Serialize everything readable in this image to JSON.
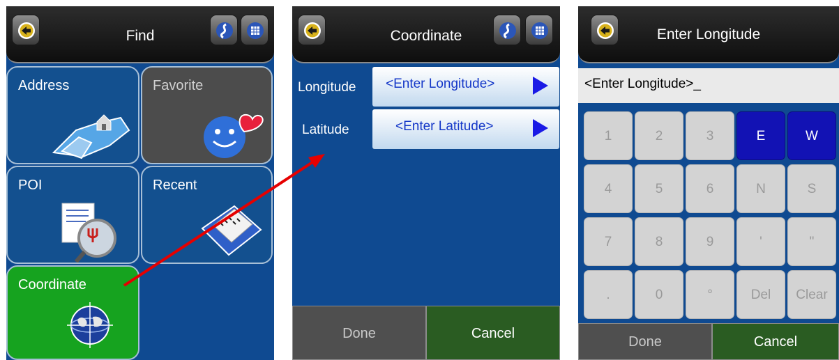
{
  "find_screen": {
    "title": "Find",
    "tiles": [
      {
        "label": "Address",
        "state": "enabled"
      },
      {
        "label": "Favorite",
        "state": "disabled"
      },
      {
        "label": "POI",
        "state": "enabled"
      },
      {
        "label": "Recent",
        "state": "enabled"
      },
      {
        "label": "Coordinate",
        "state": "selected"
      }
    ],
    "icons": {
      "back": "back-arrow-icon",
      "route": "route-icon",
      "menu": "menu-icon"
    }
  },
  "coordinate_screen": {
    "title": "Coordinate",
    "fields": [
      {
        "label": "Longitude",
        "value": "<Enter Longitude>"
      },
      {
        "label": "Latitude",
        "value": "<Enter Latitude>"
      }
    ],
    "buttons": {
      "done": "Done",
      "cancel": "Cancel"
    }
  },
  "longitude_screen": {
    "title": "Enter Longitude",
    "input_value": "<Enter Longitude>_",
    "keys": [
      [
        "1",
        "2",
        "3",
        "E",
        "W"
      ],
      [
        "4",
        "5",
        "6",
        "N",
        "S"
      ],
      [
        "7",
        "8",
        "9",
        "'",
        "\""
      ],
      [
        ".",
        "0",
        "°",
        "Del",
        "Clear"
      ]
    ],
    "highlighted_keys": [
      "E",
      "W"
    ],
    "buttons": {
      "done": "Done",
      "cancel": "Cancel"
    }
  },
  "colors": {
    "screen_bg": "#0f4a91",
    "accent_green": "#16a31f",
    "key_highlight": "#1212b4",
    "arrow": "#e60000"
  }
}
